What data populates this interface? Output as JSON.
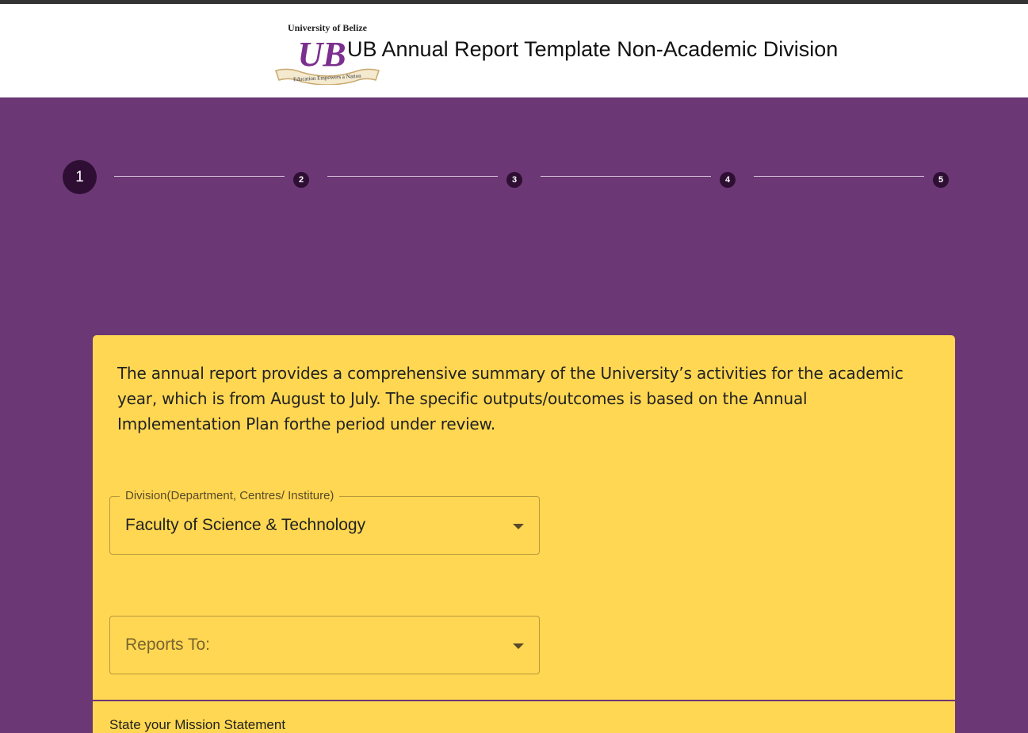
{
  "header": {
    "logo": {
      "top_text": "University of Belize",
      "monogram": "UB",
      "banner_text": "Education Empowers a Nation",
      "colors": {
        "purple": "#7b2f8e",
        "gold": "#c9a96e"
      }
    },
    "title": "UB Annual Report Template Non-Academic Division"
  },
  "stepper": {
    "steps": [
      "1",
      "2",
      "3",
      "4",
      "5"
    ],
    "active_step": "1"
  },
  "form": {
    "intro": "The annual report provides a comprehensive summary of the University’s activities for the academic year, which is from August to July. The specific outputs/outcomes is based on the Annual Implementation Plan forthe period under review.",
    "division": {
      "label": "Division(Department, Centres/ Institure)",
      "value": "Faculty of Science & Technology"
    },
    "reports_to": {
      "placeholder": "Reports To:"
    },
    "mission_label": "State your Mission Statement"
  },
  "colors": {
    "background": "#6b3775",
    "card": "#ffd752",
    "step": "#2e0f33",
    "topbar": "#333333"
  }
}
